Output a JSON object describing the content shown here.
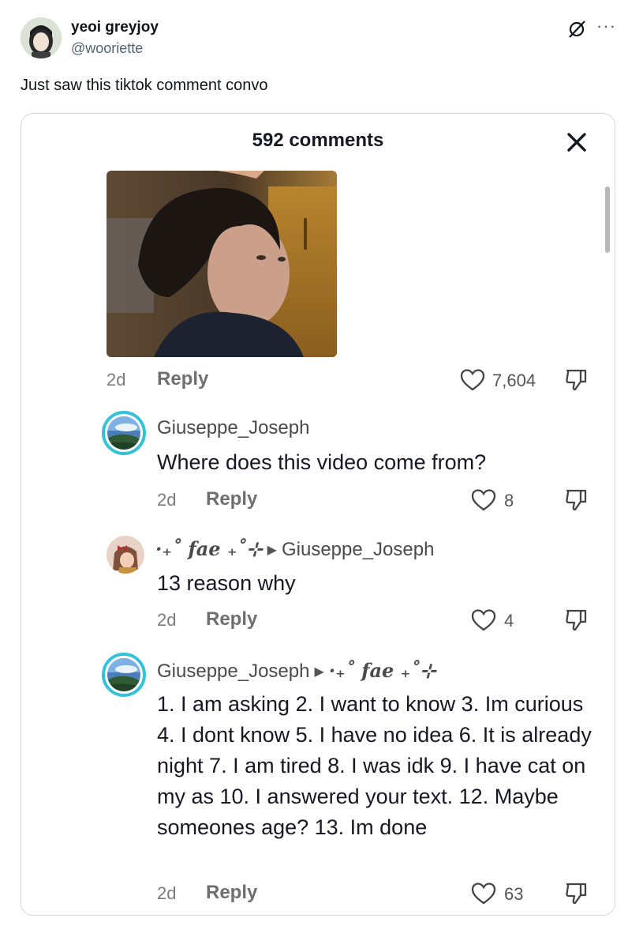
{
  "tweet": {
    "display_name": "yeoi greyjoy",
    "handle": "@wooriette",
    "text": "Just saw this tiktok comment convo",
    "more_label": "···"
  },
  "screenshot": {
    "comments_count": "592 comments",
    "top_comment": {
      "time": "2d",
      "reply_label": "Reply",
      "likes": "7,604"
    },
    "comments": [
      {
        "username": "Giuseppe_Joseph",
        "text": "Where does this video come from?",
        "time": "2d",
        "reply_label": "Reply",
        "likes": "8"
      },
      {
        "username": "·₊˚ 𝒇𝒂𝒆 ₊˚⊹",
        "reply_to": "Giuseppe_Joseph",
        "text": "13 reason why",
        "time": "2d",
        "reply_label": "Reply",
        "likes": "4"
      },
      {
        "username": "Giuseppe_Joseph",
        "reply_to": "·₊˚ 𝒇𝒂𝒆 ₊˚⊹",
        "text": "1. I am asking 2. I want to know 3. Im curious 4. I dont know 5. I have no idea 6. It is already night 7. I am tired 8. I was idk 9. I have cat on my as 10. I answered your text. 12. Maybe someones age? 13. Im done",
        "time": "2d",
        "reply_label": "Reply",
        "likes": "63"
      }
    ]
  },
  "colors": {
    "avatar_ring": "#35c2d8",
    "handle_gray": "#536471",
    "card_border": "#cfd9de"
  }
}
